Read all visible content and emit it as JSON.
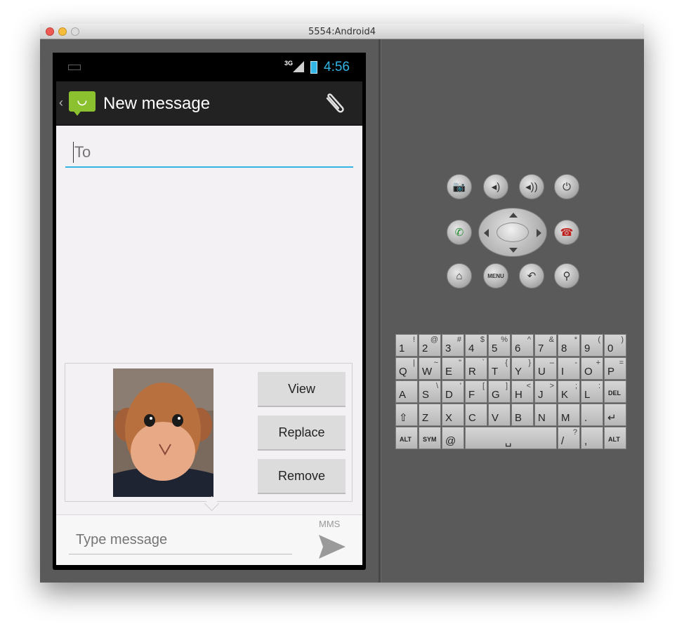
{
  "window": {
    "title": "5554:Android4"
  },
  "status_bar": {
    "network": "3G",
    "time": "4:56"
  },
  "action_bar": {
    "title": "New message",
    "icons": [
      "messaging-app-icon",
      "paperclip-icon"
    ]
  },
  "compose": {
    "to_placeholder": "To",
    "attachment": {
      "type": "photo",
      "view_label": "View",
      "replace_label": "Replace",
      "remove_label": "Remove"
    },
    "message_placeholder": "Type message",
    "mms_label": "MMS"
  },
  "hardware_buttons": {
    "row1": [
      "camera-icon",
      "volume-down-icon",
      "volume-up-icon",
      "power-icon"
    ],
    "row2": [
      "call-icon",
      "dpad",
      "end-call-icon"
    ],
    "row3": [
      "home-icon",
      "menu-icon",
      "back-icon",
      "search-icon"
    ],
    "menu_label": "MENU"
  },
  "keyboard": {
    "rows": [
      [
        {
          "k": "1",
          "a": "!"
        },
        {
          "k": "2",
          "a": "@"
        },
        {
          "k": "3",
          "a": "#"
        },
        {
          "k": "4",
          "a": "$"
        },
        {
          "k": "5",
          "a": "%"
        },
        {
          "k": "6",
          "a": "^"
        },
        {
          "k": "7",
          "a": "&"
        },
        {
          "k": "8",
          "a": "*"
        },
        {
          "k": "9",
          "a": "("
        },
        {
          "k": "0",
          "a": ")"
        }
      ],
      [
        {
          "k": "Q",
          "a": "|"
        },
        {
          "k": "W",
          "a": "~"
        },
        {
          "k": "E",
          "a": "\""
        },
        {
          "k": "R",
          "a": "`"
        },
        {
          "k": "T",
          "a": "{"
        },
        {
          "k": "Y",
          "a": "}"
        },
        {
          "k": "U",
          "a": "–"
        },
        {
          "k": "I",
          "a": "-"
        },
        {
          "k": "O",
          "a": "+"
        },
        {
          "k": "P",
          "a": "="
        }
      ],
      [
        {
          "k": "A",
          "a": ""
        },
        {
          "k": "S",
          "a": "\\"
        },
        {
          "k": "D",
          "a": "'"
        },
        {
          "k": "F",
          "a": "["
        },
        {
          "k": "G",
          "a": "]"
        },
        {
          "k": "H",
          "a": "<"
        },
        {
          "k": "J",
          "a": ">"
        },
        {
          "k": "K",
          "a": ";"
        },
        {
          "k": "L",
          "a": ":"
        },
        {
          "k": "DEL",
          "a": ""
        }
      ],
      [
        {
          "k": "⇧",
          "a": ""
        },
        {
          "k": "Z",
          "a": ""
        },
        {
          "k": "X",
          "a": ""
        },
        {
          "k": "C",
          "a": ""
        },
        {
          "k": "V",
          "a": ""
        },
        {
          "k": "B",
          "a": ""
        },
        {
          "k": "N",
          "a": ""
        },
        {
          "k": "M",
          "a": ""
        },
        {
          "k": ".",
          "a": ""
        },
        {
          "k": "↵",
          "a": ""
        }
      ],
      [
        {
          "k": "ALT",
          "a": ""
        },
        {
          "k": "SYM",
          "a": ""
        },
        {
          "k": "@",
          "a": ""
        },
        {
          "k": "␣",
          "a": ""
        },
        {
          "k": "/",
          "a": "?"
        },
        {
          "k": ",",
          "a": ""
        },
        {
          "k": "ALT",
          "a": ""
        }
      ]
    ]
  }
}
